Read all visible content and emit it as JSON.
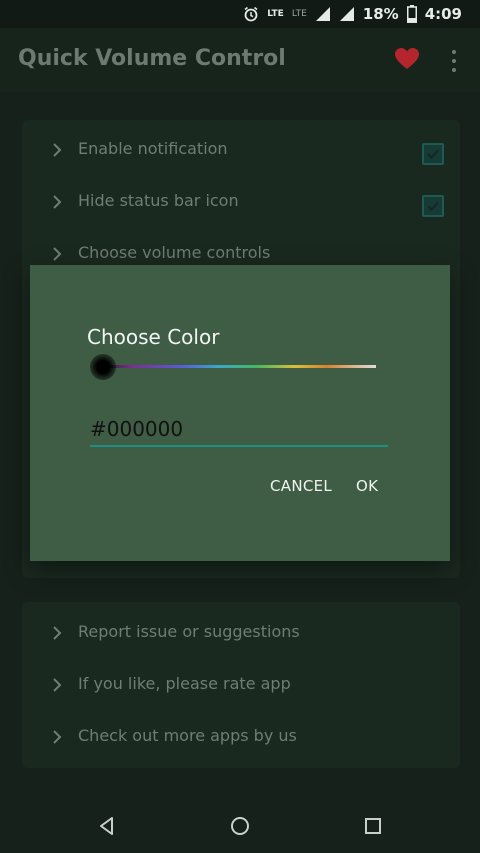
{
  "status_bar": {
    "lte1": "LTE",
    "lte2": "LTE",
    "battery": "18%",
    "time": "4:09"
  },
  "app_bar": {
    "title": "Quick Volume Control",
    "icons": [
      "heart-icon",
      "more-vert-icon"
    ],
    "heart_color": "#b3262e"
  },
  "settings_card": {
    "rows": [
      {
        "label": "Enable notification",
        "checked": true
      },
      {
        "label": "Hide status bar icon",
        "checked": true
      },
      {
        "label": "Choose volume controls"
      }
    ]
  },
  "about_card": {
    "rows": [
      {
        "label": "Report issue or suggestions"
      },
      {
        "label": "If you like, please rate app"
      },
      {
        "label": "Check out more apps by us"
      }
    ]
  },
  "dialog": {
    "title": "Choose Color",
    "hex_value": "#000000",
    "cancel_label": "CANCEL",
    "ok_label": "OK",
    "background": "#3f5c44",
    "accent": "#1f8f86"
  },
  "nav_bar": {
    "icons": [
      "back-icon",
      "home-icon",
      "recents-icon"
    ]
  }
}
